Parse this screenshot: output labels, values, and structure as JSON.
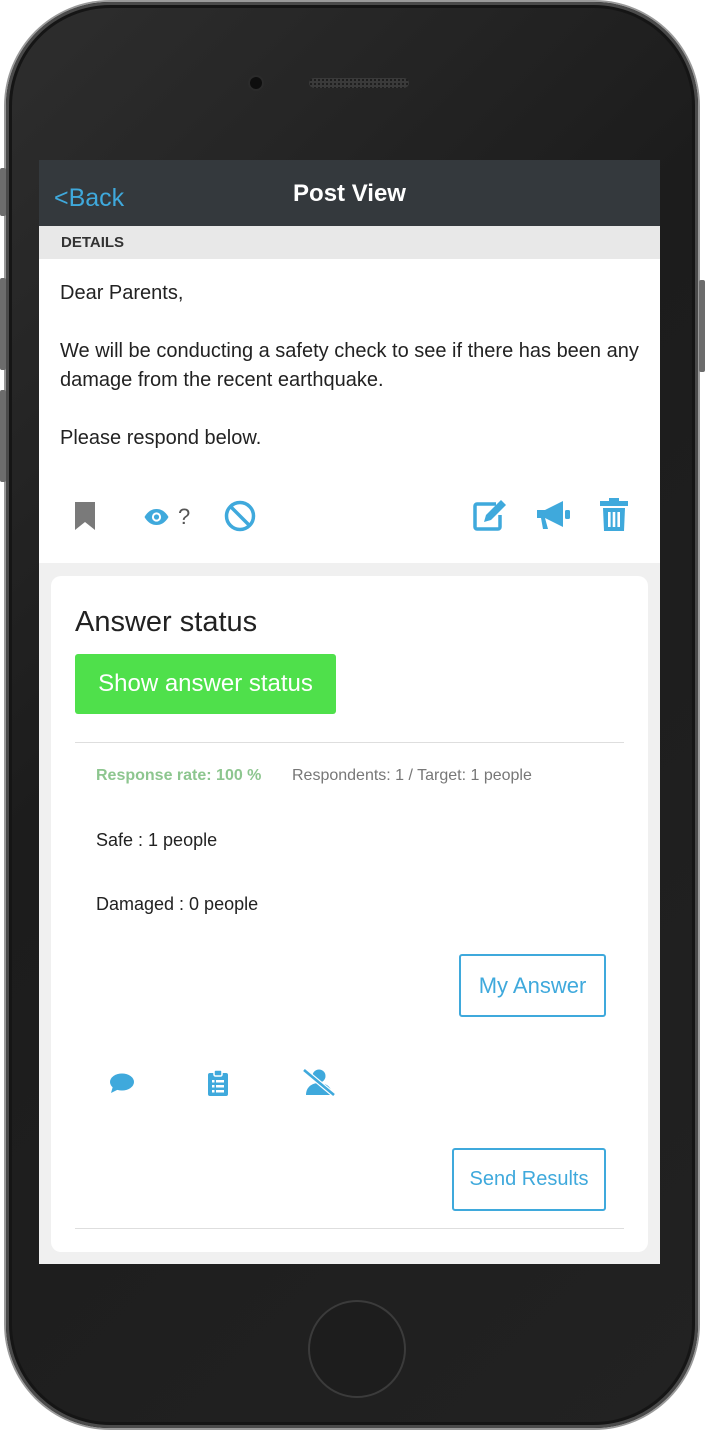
{
  "header": {
    "back_label": "<Back",
    "title": "Post View"
  },
  "details": {
    "section_label": "DETAILS",
    "paragraphs": [
      "Dear Parents,",
      "We will be conducting a safety check to see if there has been any damage from the recent earthquake.",
      "Please respond below."
    ]
  },
  "post_actions": {
    "read_count": "?",
    "icons": [
      "bookmark-icon",
      "eye-icon",
      "block-icon",
      "edit-icon",
      "megaphone-icon",
      "trash-icon"
    ]
  },
  "answer_status": {
    "title": "Answer status",
    "show_button": "Show answer status",
    "response_rate": "Response rate: 100 %",
    "respondents": "Respondents: 1 / Target: 1 people",
    "safe": "Safe : 1 people",
    "damaged": "Damaged : 0 people",
    "my_answer_button": "My Answer",
    "send_results_button": "Send Results",
    "icons": [
      "comment-icon",
      "clipboard-icon",
      "user-slash-icon"
    ]
  },
  "colors": {
    "accent": "#3fa9dc",
    "navbar": "#34393d",
    "success_button": "#4fe04b",
    "response_rate": "#8dc68f"
  }
}
